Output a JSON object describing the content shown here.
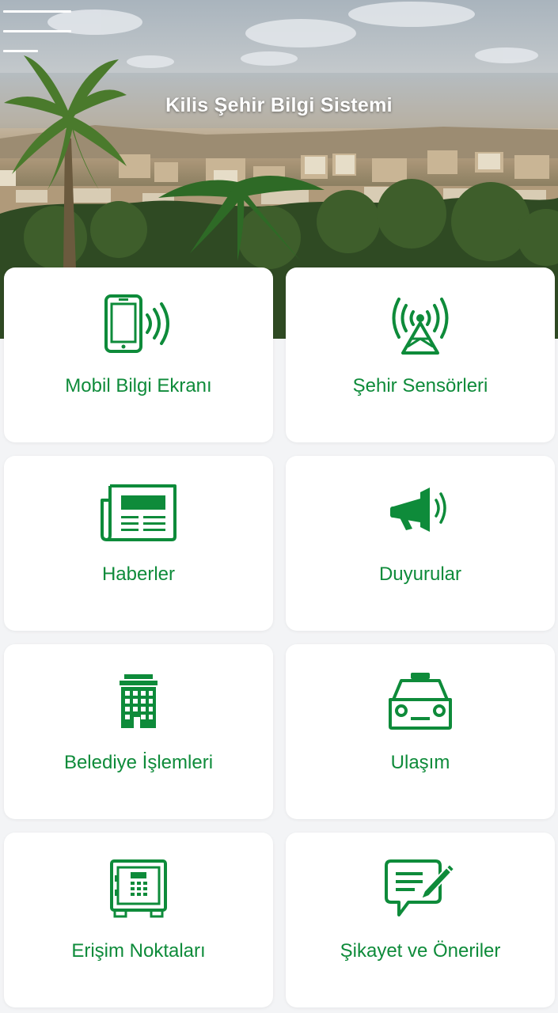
{
  "header": {
    "title": "Kilis Şehir Bilgi Sistemi",
    "menu_icon": "hamburger-menu-icon"
  },
  "theme": {
    "accent": "#0e8b3a",
    "card_background": "#ffffff",
    "page_background": "#f3f4f6"
  },
  "menu": {
    "items": [
      {
        "label": "Mobil Bilgi Ekranı",
        "icon": "mobile-phone-signal-icon"
      },
      {
        "label": "Şehir Sensörleri",
        "icon": "antenna-tower-icon"
      },
      {
        "label": "Haberler",
        "icon": "newspaper-icon"
      },
      {
        "label": "Duyurular",
        "icon": "megaphone-icon"
      },
      {
        "label": "Belediye İşlemleri",
        "icon": "building-icon"
      },
      {
        "label": "Ulaşım",
        "icon": "taxi-icon"
      },
      {
        "label": "Erişim Noktaları",
        "icon": "safe-icon"
      },
      {
        "label": "Şikayet ve Öneriler",
        "icon": "feedback-message-icon"
      }
    ]
  }
}
